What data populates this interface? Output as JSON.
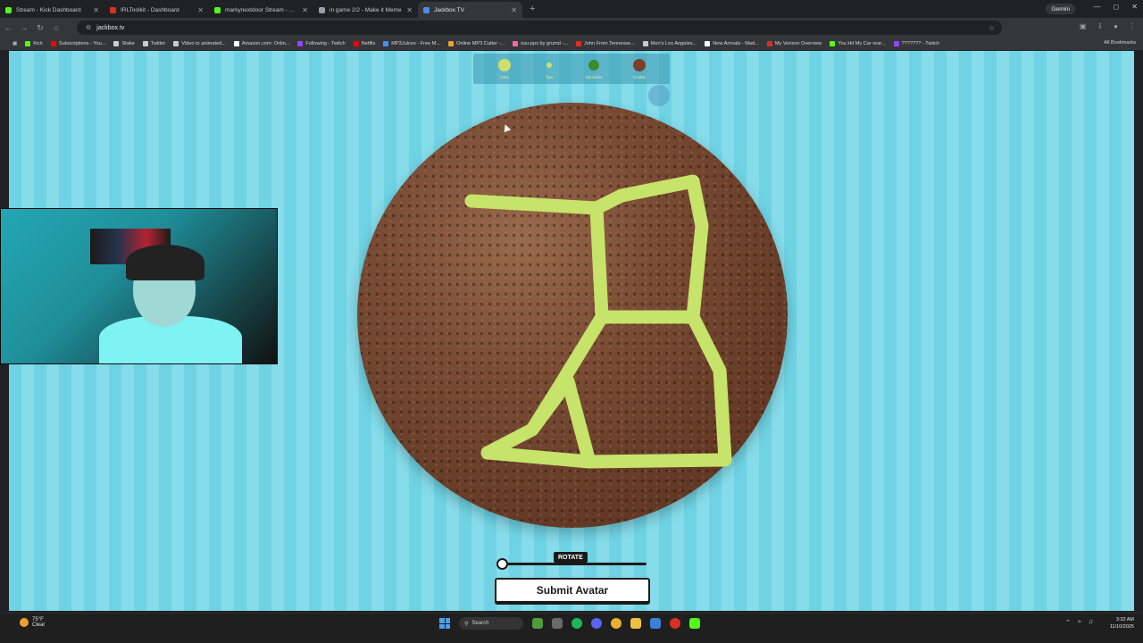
{
  "browser": {
    "tabs": [
      {
        "title": "Stream - Kick Dashboard",
        "color": "#53fc18",
        "active": false
      },
      {
        "title": "IRLToolkit - Dashboard",
        "color": "#d93025",
        "active": false
      },
      {
        "title": "markynextdoor Stream - Watch",
        "color": "#53fc18",
        "active": false
      },
      {
        "title": "in game 2/2 - Make it Meme",
        "color": "#9aa0a6",
        "active": false
      },
      {
        "title": "Jackbox.TV",
        "color": "#4a8df0",
        "active": true
      }
    ],
    "new_tab_symbol": "+",
    "gemini_label": "Gemini",
    "url": "jackbox.tv",
    "bookmarks": [
      {
        "label": "Kick",
        "color": "#53fc18"
      },
      {
        "label": "Subscriptions - You...",
        "color": "#ff0000"
      },
      {
        "label": "Stake",
        "color": "#cccccc"
      },
      {
        "label": "Twitter",
        "color": "#cccccc"
      },
      {
        "label": "Video to animated...",
        "color": "#cccccc"
      },
      {
        "label": "Amazon.com: Onlin...",
        "color": "#ffffff"
      },
      {
        "label": "Following - Twitch",
        "color": "#9146ff"
      },
      {
        "label": "Netflix",
        "color": "#e50914"
      },
      {
        "label": "MP3Juices - Free M...",
        "color": "#4a8df0"
      },
      {
        "label": "Online MP3 Cutter -...",
        "color": "#f0a030"
      },
      {
        "label": "osu-pps by grumd -...",
        "color": "#ff66aa"
      },
      {
        "label": "John From Tennesse...",
        "color": "#d93025"
      },
      {
        "label": "Men's Los Angeles...",
        "color": "#cccccc"
      },
      {
        "label": "New Arrivals - Mad...",
        "color": "#ffffff"
      },
      {
        "label": "My Verizon Overview",
        "color": "#d93025"
      },
      {
        "label": "You Hit My Car rear...",
        "color": "#53fc18"
      },
      {
        "label": "??????? - Twitch",
        "color": "#9146ff"
      }
    ],
    "all_bookmarks_label": "All Bookmarks"
  },
  "game": {
    "tools": [
      {
        "label": "Color",
        "color": "#cde06a",
        "size": 14
      },
      {
        "label": "Tips",
        "color": "#cde06a",
        "size": 6
      },
      {
        "label": "Sprinkles",
        "color": "#3c8a2e",
        "size": 12
      },
      {
        "label": "Cookie",
        "color": "#7a4028",
        "size": 14
      }
    ],
    "rotate_label": "ROTATE",
    "rotate_value": 0,
    "submit_label": "Submit Avatar",
    "icing_color": "#c6e36a"
  },
  "taskbar": {
    "weather_temp": "75°F",
    "weather_desc": "Clear",
    "search_label": "Search",
    "time": "3:32 AM",
    "date": "11/10/2025"
  }
}
